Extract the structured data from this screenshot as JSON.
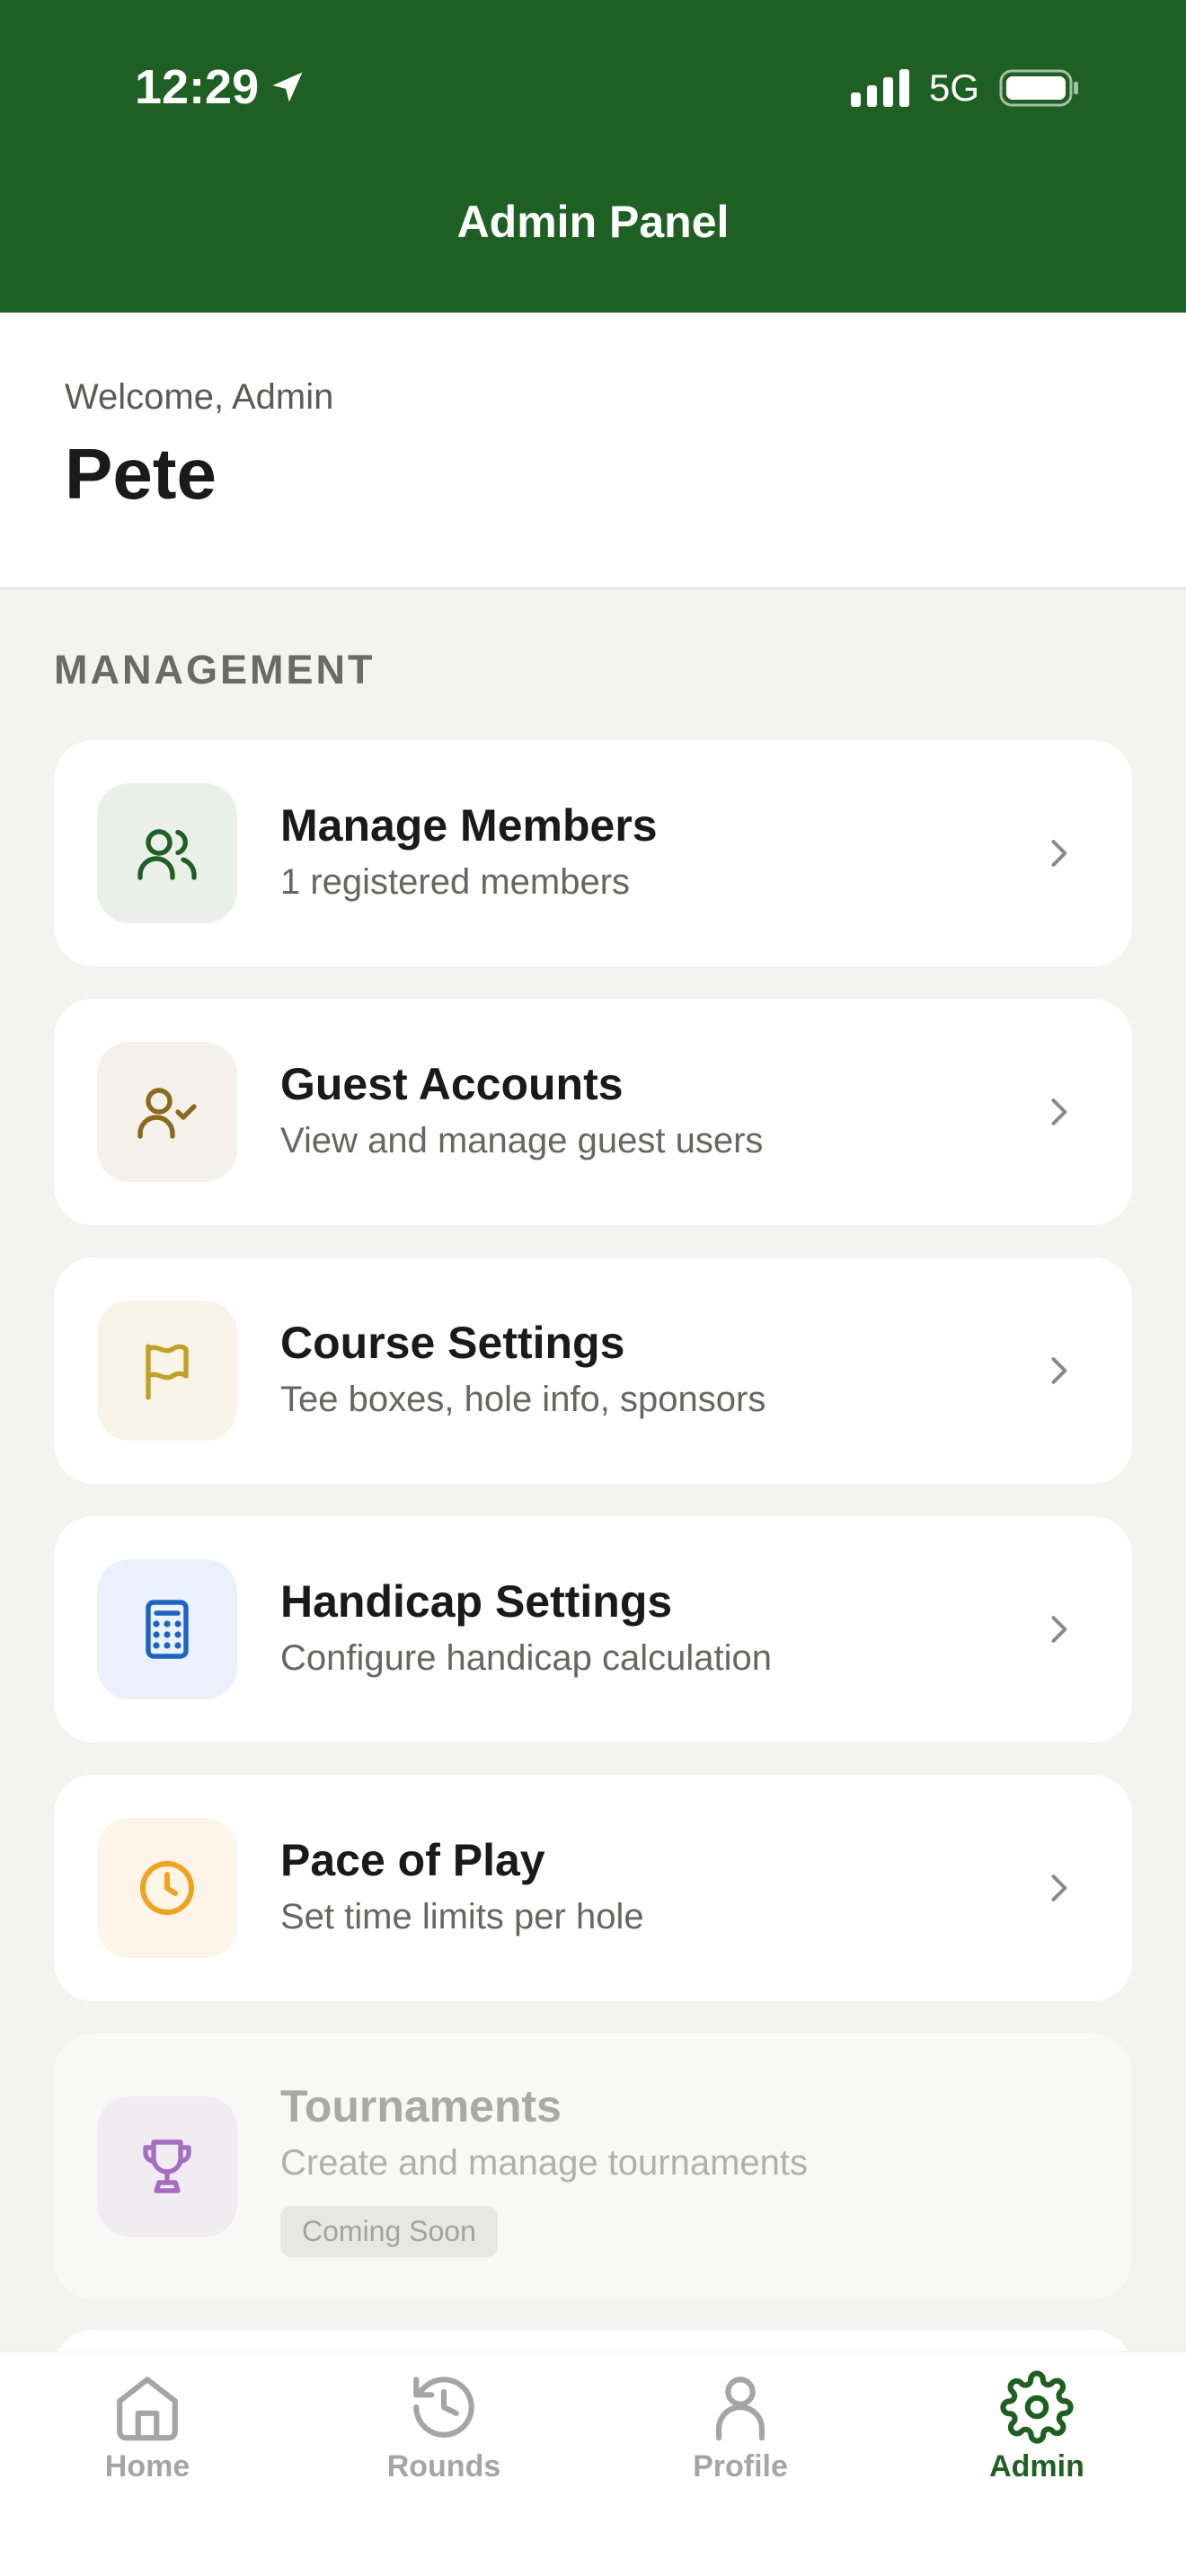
{
  "status_bar": {
    "time": "12:29",
    "network": "5G"
  },
  "header": {
    "title": "Admin Panel"
  },
  "welcome": {
    "label": "Welcome, Admin",
    "name": "Pete"
  },
  "section": {
    "title": "MANAGEMENT"
  },
  "menu": [
    {
      "title": "Manage Members",
      "subtitle": "1 registered members",
      "icon": "users-icon",
      "icon_color": "#1f5f23",
      "icon_bg": "#ebefe9"
    },
    {
      "title": "Guest Accounts",
      "subtitle": "View and manage guest users",
      "icon": "user-check-icon",
      "icon_color": "#8a6a1e",
      "icon_bg": "#f4f1ea"
    },
    {
      "title": "Course Settings",
      "subtitle": "Tee boxes, hole info, sponsors",
      "icon": "flag-icon",
      "icon_color": "#c4a02a",
      "icon_bg": "#f8f5e8"
    },
    {
      "title": "Handicap Settings",
      "subtitle": "Configure handicap calculation",
      "icon": "calculator-icon",
      "icon_color": "#1f63c0",
      "icon_bg": "#eaf1fb"
    },
    {
      "title": "Pace of Play",
      "subtitle": "Set time limits per hole",
      "icon": "clock-icon",
      "icon_color": "#f0a323",
      "icon_bg": "#fdf5e8"
    },
    {
      "title": "Tournaments",
      "subtitle": "Create and manage tournaments",
      "badge": "Coming Soon",
      "icon": "trophy-icon",
      "icon_color": "#a46fc0",
      "icon_bg": "#f1ecf2",
      "disabled": true
    }
  ],
  "tabs": [
    {
      "label": "Home",
      "icon": "home-icon",
      "active": false
    },
    {
      "label": "Rounds",
      "icon": "history-icon",
      "active": false
    },
    {
      "label": "Profile",
      "icon": "person-icon",
      "active": false
    },
    {
      "label": "Admin",
      "icon": "gear-icon",
      "active": true
    }
  ],
  "colors": {
    "brand_green": "#1f5f23",
    "background": "#f3f3ef",
    "tab_inactive": "#a5a5a5"
  }
}
